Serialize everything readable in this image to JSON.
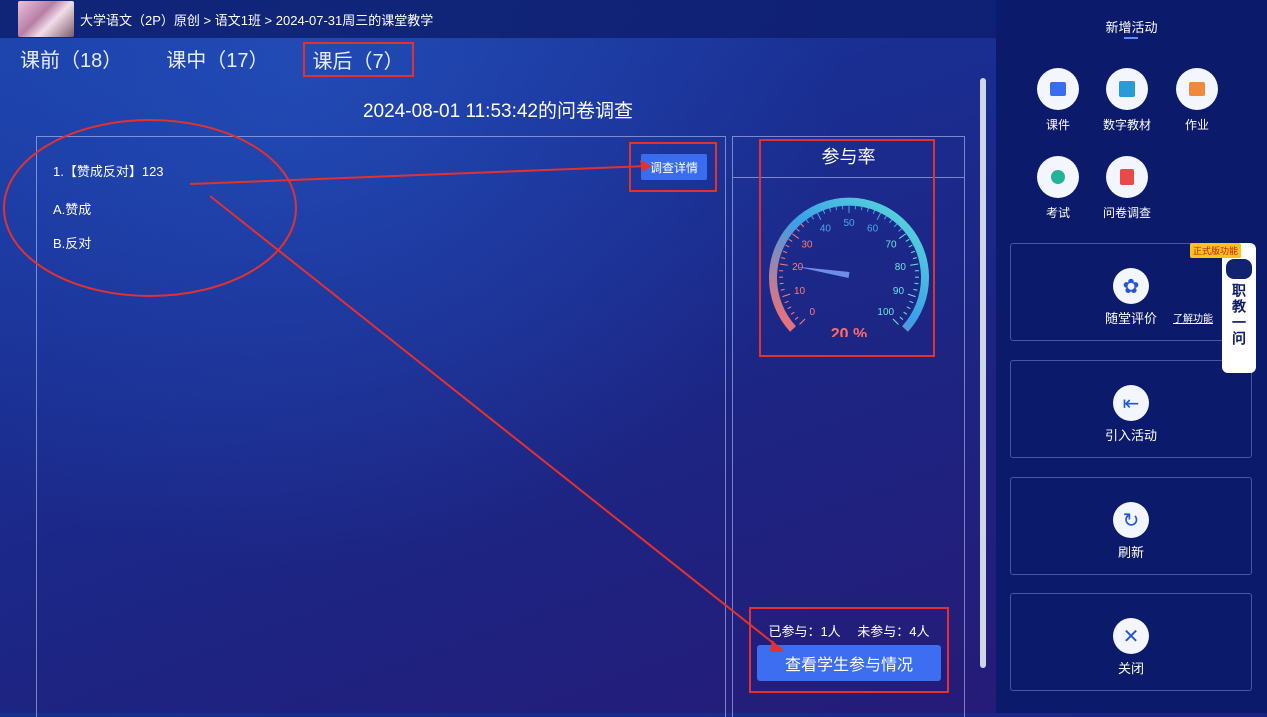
{
  "header": {
    "breadcrumb": "大学语文（2P）原创 > 语文1班 > 2024-07-31周三的课堂教学"
  },
  "tabs": [
    {
      "label": "课前（18）"
    },
    {
      "label": "课中（17）"
    },
    {
      "label": "课后（7）"
    }
  ],
  "survey": {
    "title": "2024-08-01 11:53:42的问卷调查",
    "question": "1.【赞成反对】123",
    "options": [
      "A.赞成",
      "B.反对"
    ],
    "detail_button": "调查详情"
  },
  "rate": {
    "title": "参与率",
    "value_text": "20 %",
    "value": 20,
    "ticks": [
      "0",
      "10",
      "20",
      "30",
      "40",
      "50",
      "60",
      "70",
      "80",
      "90",
      "100"
    ],
    "stats": "已参与：1人　 未参与：4人",
    "view_button": "查看学生参与情况"
  },
  "sidebar": {
    "title": "新增活动",
    "tools": [
      {
        "label": "课件",
        "icon": "courseware-icon",
        "color": "#3a6cf0"
      },
      {
        "label": "数字教材",
        "icon": "digital-textbook-icon",
        "color": "#2b9ad8"
      },
      {
        "label": "作业",
        "icon": "homework-icon",
        "color": "#f08a3a"
      },
      {
        "label": "考试",
        "icon": "exam-icon",
        "color": "#22b39a"
      },
      {
        "label": "问卷调查",
        "icon": "survey-icon",
        "color": "#e64a4a"
      }
    ],
    "cards": [
      {
        "label": "随堂评价",
        "icon": "flower-icon"
      },
      {
        "label": "引入活动",
        "icon": "import-icon"
      },
      {
        "label": "刷新",
        "icon": "refresh-icon"
      },
      {
        "label": "关闭",
        "icon": "close-icon"
      }
    ],
    "learn_link": "了解功能",
    "robot_badge": "正式版功能",
    "robot_label": "职教一问"
  }
}
